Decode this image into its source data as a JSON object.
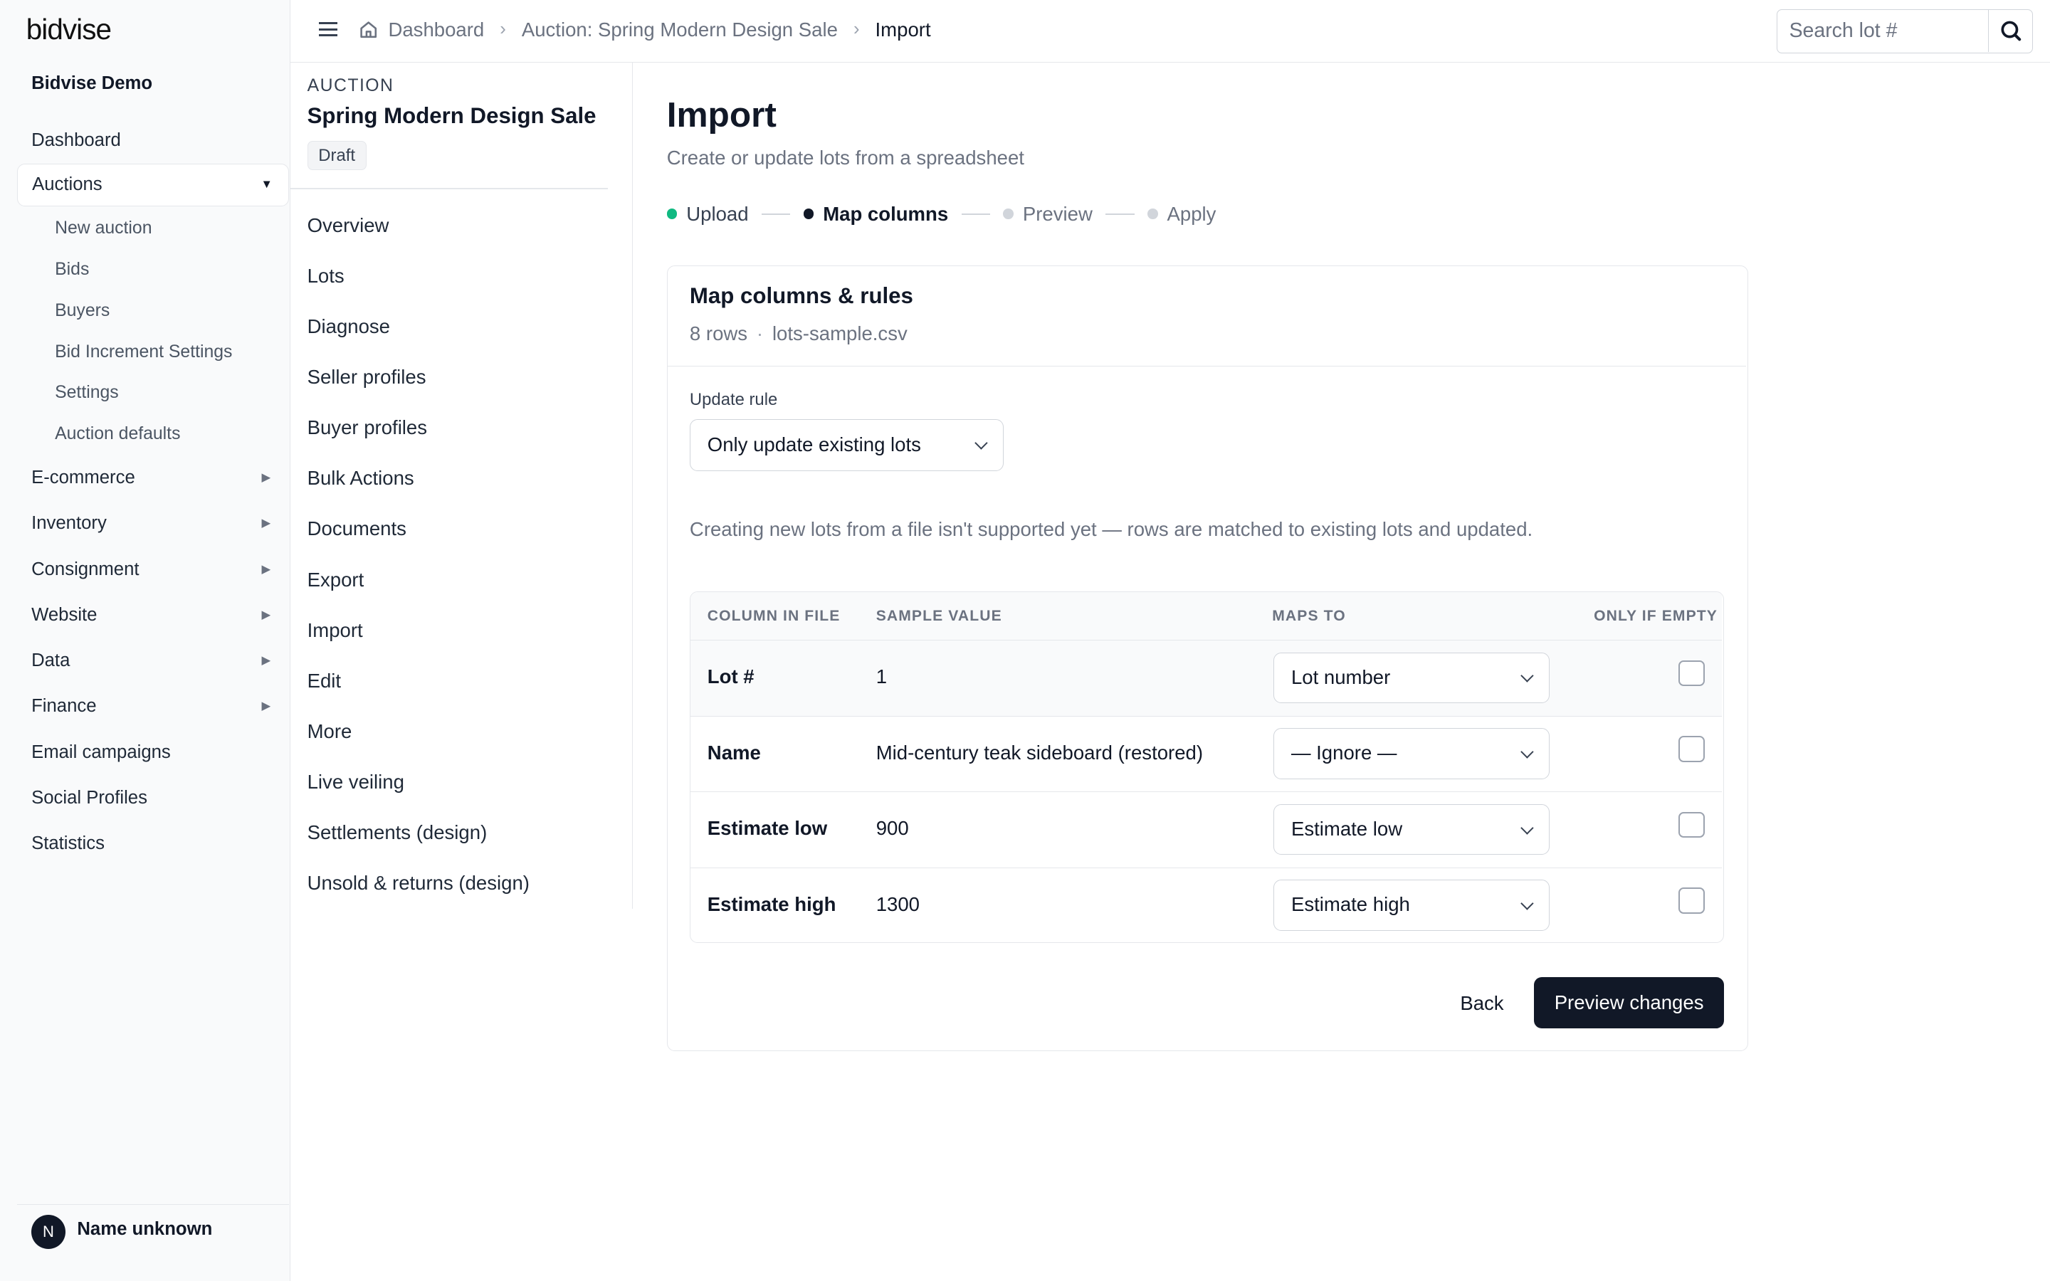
{
  "brand": {
    "logo": "bidvise",
    "org": "Bidvise Demo"
  },
  "sidebar": {
    "dashboard": "Dashboard",
    "auctions": "Auctions",
    "auction_sub": [
      "New auction",
      "Bids",
      "Buyers",
      "Bid Increment Settings",
      "Settings",
      "Auction defaults"
    ],
    "groups": [
      "E-commerce",
      "Inventory",
      "Consignment",
      "Website",
      "Data",
      "Finance"
    ],
    "tail": [
      "Email campaigns",
      "Social Profiles",
      "Statistics"
    ]
  },
  "user": {
    "initial": "N",
    "name": "Name unknown"
  },
  "breadcrumb": {
    "home": "Dashboard",
    "auction": "Auction: Spring Modern Design Sale",
    "current": "Import"
  },
  "search": {
    "placeholder": "Search lot #"
  },
  "auction_panel": {
    "kicker": "AUCTION",
    "title": "Spring Modern Design Sale",
    "status": "Draft",
    "nav": [
      "Overview",
      "Lots",
      "Diagnose",
      "Seller profiles",
      "Buyer profiles",
      "Bulk Actions",
      "Documents",
      "Export",
      "Import",
      "Edit",
      "More",
      "Live veiling",
      "Settlements (design)",
      "Unsold & returns (design)"
    ]
  },
  "page": {
    "title": "Import",
    "subtitle": "Create or update lots from a spreadsheet"
  },
  "steps": [
    {
      "label": "Upload",
      "state": "done"
    },
    {
      "label": "Map columns",
      "state": "current"
    },
    {
      "label": "Preview",
      "state": "todo"
    },
    {
      "label": "Apply",
      "state": "todo"
    }
  ],
  "card": {
    "title": "Map columns & rules",
    "rows_count": "8 rows",
    "filename": "lots-sample.csv",
    "rule_label": "Update rule",
    "rule_value": "Only update existing lots",
    "note": "Creating new lots from a file isn't supported yet — rows are matched to existing lots and updated."
  },
  "table": {
    "headers": {
      "column": "COLUMN IN FILE",
      "sample": "SAMPLE VALUE",
      "maps": "MAPS TO",
      "only_empty": "ONLY IF EMPTY"
    },
    "rows": [
      {
        "column": "Lot #",
        "sample": "1",
        "maps_to": "Lot number",
        "only_if_empty": false
      },
      {
        "column": "Name",
        "sample": "Mid-century teak sideboard (restored)",
        "maps_to": "— Ignore —",
        "only_if_empty": false
      },
      {
        "column": "Estimate low",
        "sample": "900",
        "maps_to": "Estimate low",
        "only_if_empty": false
      },
      {
        "column": "Estimate high",
        "sample": "1300",
        "maps_to": "Estimate high",
        "only_if_empty": false
      }
    ]
  },
  "actions": {
    "back": "Back",
    "preview": "Preview changes"
  },
  "colors": {
    "primary": "#111827",
    "step_done": "#10b981",
    "border": "#e5e7eb",
    "muted": "#6b7280"
  }
}
